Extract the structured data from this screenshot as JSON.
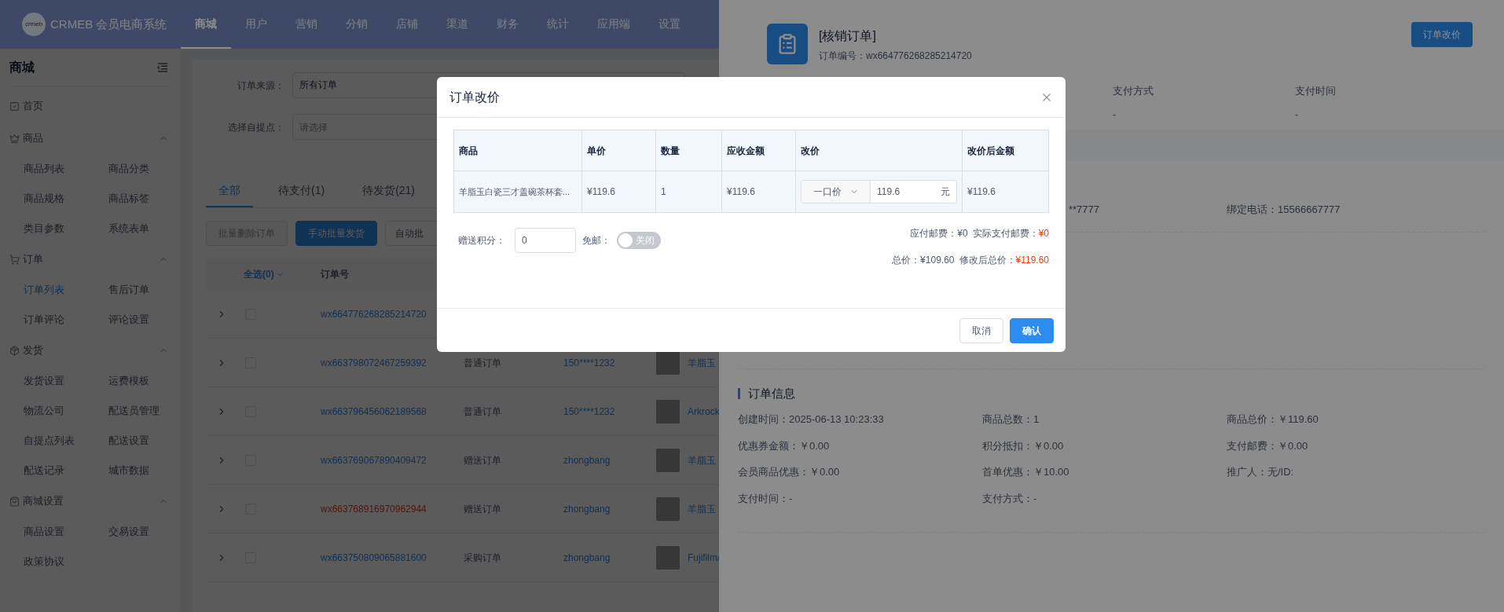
{
  "topbar": {
    "logo_text": "crmeb",
    "brand": "CRMEB 会员电商系统",
    "menu": [
      {
        "label": "商城",
        "selected": true
      },
      {
        "label": "用户",
        "selected": false
      },
      {
        "label": "营销",
        "selected": false
      },
      {
        "label": "分销",
        "selected": false
      },
      {
        "label": "店铺",
        "selected": false
      },
      {
        "label": "渠道",
        "selected": false
      },
      {
        "label": "财务",
        "selected": false
      },
      {
        "label": "统计",
        "selected": false
      },
      {
        "label": "应用端",
        "selected": false
      },
      {
        "label": "设置",
        "selected": false
      }
    ]
  },
  "sidebar": {
    "title": "商城",
    "items": [
      {
        "kind": "link",
        "label": "首页"
      },
      {
        "kind": "group",
        "label": "商品",
        "expanded": true,
        "children": [
          {
            "label": "商品列表",
            "selected": false
          },
          {
            "label": "商品分类",
            "selected": false
          },
          {
            "label": "商品规格",
            "selected": false
          },
          {
            "label": "商品标签",
            "selected": false
          },
          {
            "label": "类目参数",
            "selected": false
          },
          {
            "label": "系统表单",
            "selected": false
          }
        ]
      },
      {
        "kind": "group",
        "label": "订单",
        "expanded": true,
        "children": [
          {
            "label": "订单列表",
            "selected": true
          },
          {
            "label": "售后订单",
            "selected": false
          },
          {
            "label": "订单评论",
            "selected": false
          },
          {
            "label": "评论设置",
            "selected": false
          }
        ]
      },
      {
        "kind": "group",
        "label": "发货",
        "expanded": true,
        "children": [
          {
            "label": "发货设置",
            "selected": false
          },
          {
            "label": "运费模板",
            "selected": false
          },
          {
            "label": "物流公司",
            "selected": false
          },
          {
            "label": "配送员管理",
            "selected": false
          },
          {
            "label": "自提点列表",
            "selected": false
          },
          {
            "label": "配送设置",
            "selected": false
          },
          {
            "label": "配送记录",
            "selected": false
          },
          {
            "label": "城市数据",
            "selected": false
          }
        ]
      },
      {
        "kind": "group",
        "label": "商城设置",
        "expanded": true,
        "children": [
          {
            "label": "商品设置",
            "selected": false
          },
          {
            "label": "交易设置",
            "selected": false
          },
          {
            "label": "政策协议",
            "selected": false
          }
        ]
      }
    ]
  },
  "filters": [
    {
      "label": "订单来源：",
      "value": "所有订单"
    },
    {
      "label": "选择自提点：",
      "placeholder": "请选择"
    }
  ],
  "tabs": [
    {
      "label": "全部",
      "selected": true
    },
    {
      "label": "待支付(1)",
      "selected": false
    },
    {
      "label": "待发货(21)",
      "selected": false
    }
  ],
  "actions": [
    {
      "label": "批量删除订单",
      "kind": "disabled"
    },
    {
      "label": "手动批量发货",
      "kind": "primary"
    },
    {
      "label": "自动批",
      "kind": "default"
    }
  ],
  "table": {
    "columns": [
      "全选(0)",
      "订单号"
    ],
    "rows": [
      {
        "order_no": "wx664776268285214720",
        "checked": false,
        "flagged": false
      },
      {
        "order_no": "wx663798072467259392",
        "checked": false,
        "flagged": false,
        "type": "普通订单",
        "user": "150****1232",
        "product": "羊脂玉"
      },
      {
        "order_no": "wx663796456062189568",
        "checked": false,
        "flagged": false,
        "type": "普通订单",
        "user": "150****1232",
        "product": "Arkrock"
      },
      {
        "order_no": "wx663769067890409472",
        "checked": false,
        "flagged": false,
        "type": "赠送订单",
        "user": "zhongbang",
        "product": "羊脂玉"
      },
      {
        "order_no": "wx663768916970962944",
        "checked": false,
        "flagged": true,
        "type": "赠送订单",
        "user": "zhongbang",
        "product": "羊脂玉"
      },
      {
        "order_no": "wx663750809065881600",
        "checked": false,
        "flagged": false,
        "type": "采购订单",
        "user": "zhongbang",
        "product": "Fujifilm/"
      }
    ]
  },
  "drawer": {
    "title": "[核销订单]",
    "order_no": "订单编号：wx664776268285214720",
    "action": "订单改价",
    "summary": [
      {
        "label": "支付方式",
        "value": "-"
      },
      {
        "label": "支付时间",
        "value": "-"
      }
    ],
    "user_info": [
      "**7777",
      "绑定电话：15566667777"
    ],
    "order_info": {
      "title": "订单信息",
      "fields": [
        "创建时间：2025-06-13 10:23:33",
        "商品总数：1",
        "商品总价：￥119.60",
        "优惠券金额：￥0.00",
        "积分抵扣：￥0.00",
        "支付邮费：￥0.00",
        "会员商品优惠：￥0.00",
        "首单优惠：￥10.00",
        "推广人：无/ID:",
        "支付时间：-",
        "支付方式：-"
      ]
    }
  },
  "dialog": {
    "title": "订单改价",
    "columns": [
      "商品",
      "单价",
      "数量",
      "应收金额",
      "改价",
      "改价后金额"
    ],
    "rows": [
      {
        "product": "羊脂玉白瓷三才盖碗茶杯套...",
        "price": "¥119.6",
        "qty": "1",
        "receivable": "¥119.6",
        "mode": "一口价",
        "new_price": "119.6",
        "unit": "元",
        "after": "¥119.6"
      }
    ],
    "points": {
      "label": "赠送积分：",
      "value": "0"
    },
    "free_shipping": {
      "label": "免邮：",
      "on": false,
      "text": "关闭"
    },
    "totals": [
      [
        {
          "label": "应付邮费：",
          "value": "¥0",
          "emphasis": false
        },
        {
          "label": "实际支付邮费：",
          "value": "¥0",
          "emphasis": true
        }
      ],
      [
        {
          "label": "总价：",
          "value": "¥109.60",
          "emphasis": false
        },
        {
          "label": "修改后总价：",
          "value": "¥119.60",
          "emphasis": true
        }
      ]
    ],
    "buttons": [
      {
        "label": "取消",
        "kind": "default"
      },
      {
        "label": "确认",
        "kind": "primary"
      }
    ]
  }
}
